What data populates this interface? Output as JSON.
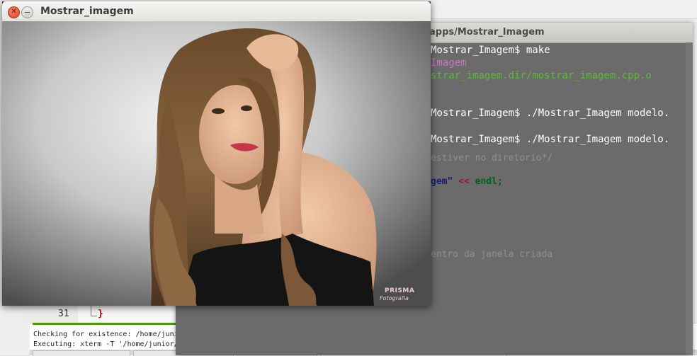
{
  "viewer": {
    "title": "Mostrar_imagem",
    "watermark_line1": "PRISMA",
    "watermark_line2": "Fotografia"
  },
  "terminal": {
    "title": "apps/Mostrar_Imagem",
    "lines": [
      "Mostrar_Imagem$ make",
      "Imagem",
      "strar_imagem.dir/mostrar_imagem.cpp.o",
      "Mostrar_Imagem$ ./Mostrar_Imagem modelo.",
      "Mostrar_Imagem$ ./Mostrar_Imagem modelo.",
      "estiver no diretorio*/",
      "entro da janela criada"
    ],
    "code_string": "gem\"",
    "code_operator": "<<",
    "code_keyword": "endl",
    "code_semicolon": ";"
  },
  "editor": {
    "line_number": "31",
    "line_content": "}"
  },
  "log": {
    "line1": "Checking for existence: /home/junior/Desktop/nomes",
    "line2": "Executing: xterm -T '/home/junior/Desktop/nomes' -e /usr/bin/cb_console_runner \"/home/junior/Desktop/nomes\" (in /home/junior/Desktop)"
  },
  "icons": {
    "close": "close-icon",
    "minimize": "minimize-icon"
  },
  "colors": {
    "terminal_bg": "#6b6b6b",
    "terminal_green": "#5fb83a",
    "terminal_magenta": "#c873c8",
    "close_button": "#d8451f"
  }
}
